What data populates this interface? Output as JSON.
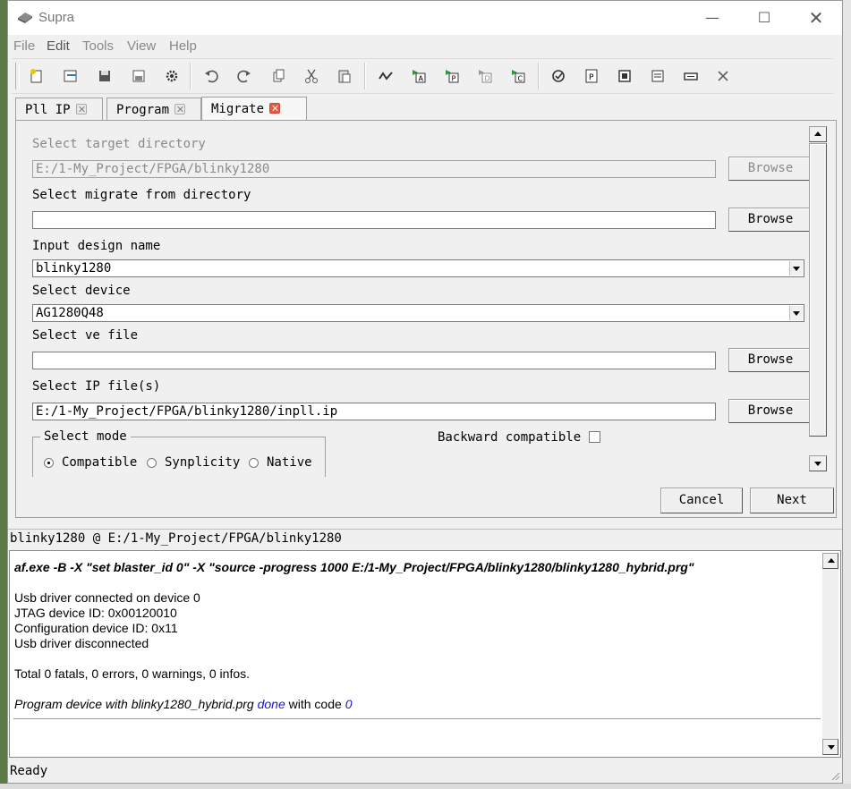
{
  "window": {
    "title": "Supra"
  },
  "menu": {
    "items": [
      "File",
      "Edit",
      "Tools",
      "View",
      "Help"
    ]
  },
  "toolbar": {
    "icons": [
      "new-project-icon",
      "open-project-icon",
      "save-icon",
      "save-as-icon",
      "settings-icon",
      "undo-icon",
      "redo-icon",
      "copy-icon",
      "cut-icon",
      "paste-icon",
      "compile-icon",
      "run-a-icon",
      "run-p-icon",
      "run-d-icon",
      "run-c-icon",
      "check-icon",
      "program-icon",
      "chip-icon",
      "report-icon",
      "device-icon",
      "clear-icon"
    ]
  },
  "tabs": [
    {
      "label": "Pll IP",
      "active": false
    },
    {
      "label": "Program",
      "active": false
    },
    {
      "label": "Migrate",
      "active": true
    }
  ],
  "migrate": {
    "target_dir_label": "Select target directory",
    "target_dir_value": "E:/1-My_Project/FPGA/blinky1280",
    "migrate_from_label": "Select migrate from directory",
    "migrate_from_value": "",
    "design_name_label": "Input design name",
    "design_name_value": "blinky1280",
    "device_label": "Select device",
    "device_value": "AG1280Q48",
    "ve_file_label": "Select ve file",
    "ve_file_value": "",
    "ip_files_label": "Select IP file(s)",
    "ip_files_value": "E:/1-My_Project/FPGA/blinky1280/inpll.ip",
    "browse_label": "Browse",
    "mode_title": "Select mode",
    "mode_options": [
      "Compatible",
      "Synplicity",
      "Native"
    ],
    "mode_selected": "Compatible",
    "backward_compatible_label": "Backward compatible",
    "backward_compatible_checked": false,
    "cancel_label": "Cancel",
    "next_label": "Next"
  },
  "project_path": "blinky1280 @ E:/1-My_Project/FPGA/blinky1280",
  "log": {
    "command": "af.exe -B -X \"set blaster_id 0\" -X \"source -progress 1000 E:/1-My_Project/FPGA/blinky1280/blinky1280_hybrid.prg\"",
    "lines": [
      "Usb driver connected on device 0",
      "JTAG device ID: 0x00120010",
      "Configuration device ID: 0x11",
      "Usb driver disconnected"
    ],
    "summary": "Total 0 fatals, 0 errors, 0 warnings, 0 infos.",
    "result_prefix": "Program device with blinky1280_hybrid.prg ",
    "result_status": "done",
    "result_middle": " with code ",
    "result_code": "0"
  },
  "status": "Ready",
  "colors": {
    "link_blue": "#1818c8",
    "tab_close_active": "#e25d3e"
  }
}
